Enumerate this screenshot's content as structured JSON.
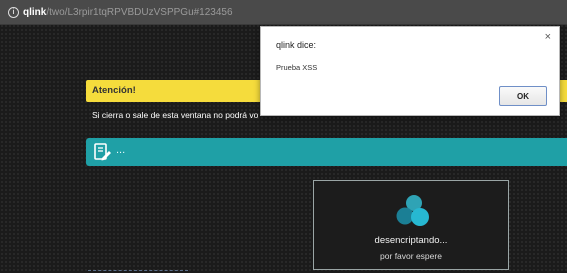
{
  "address_bar": {
    "icon": "info-icon",
    "host": "qlink",
    "path": "/two/L3rpir1tqRPVBDUzVSPPGu#123456"
  },
  "page": {
    "alert_title": "Atención!",
    "warning_text": "Si cierra o sale de esta ventana no podrá vo",
    "teal_bar_icon": "edit-form-icon",
    "teal_bar_text": "..."
  },
  "dialog": {
    "title": "qlink dice:",
    "message": "Prueba XSS",
    "ok_label": "OK",
    "close_label": "×"
  },
  "loading": {
    "line1": "desencriptando...",
    "line2": "por favor espere"
  },
  "colors": {
    "alert_yellow": "#f5dc3c",
    "teal": "#1fa0a6",
    "background": "#1b1b1b"
  }
}
